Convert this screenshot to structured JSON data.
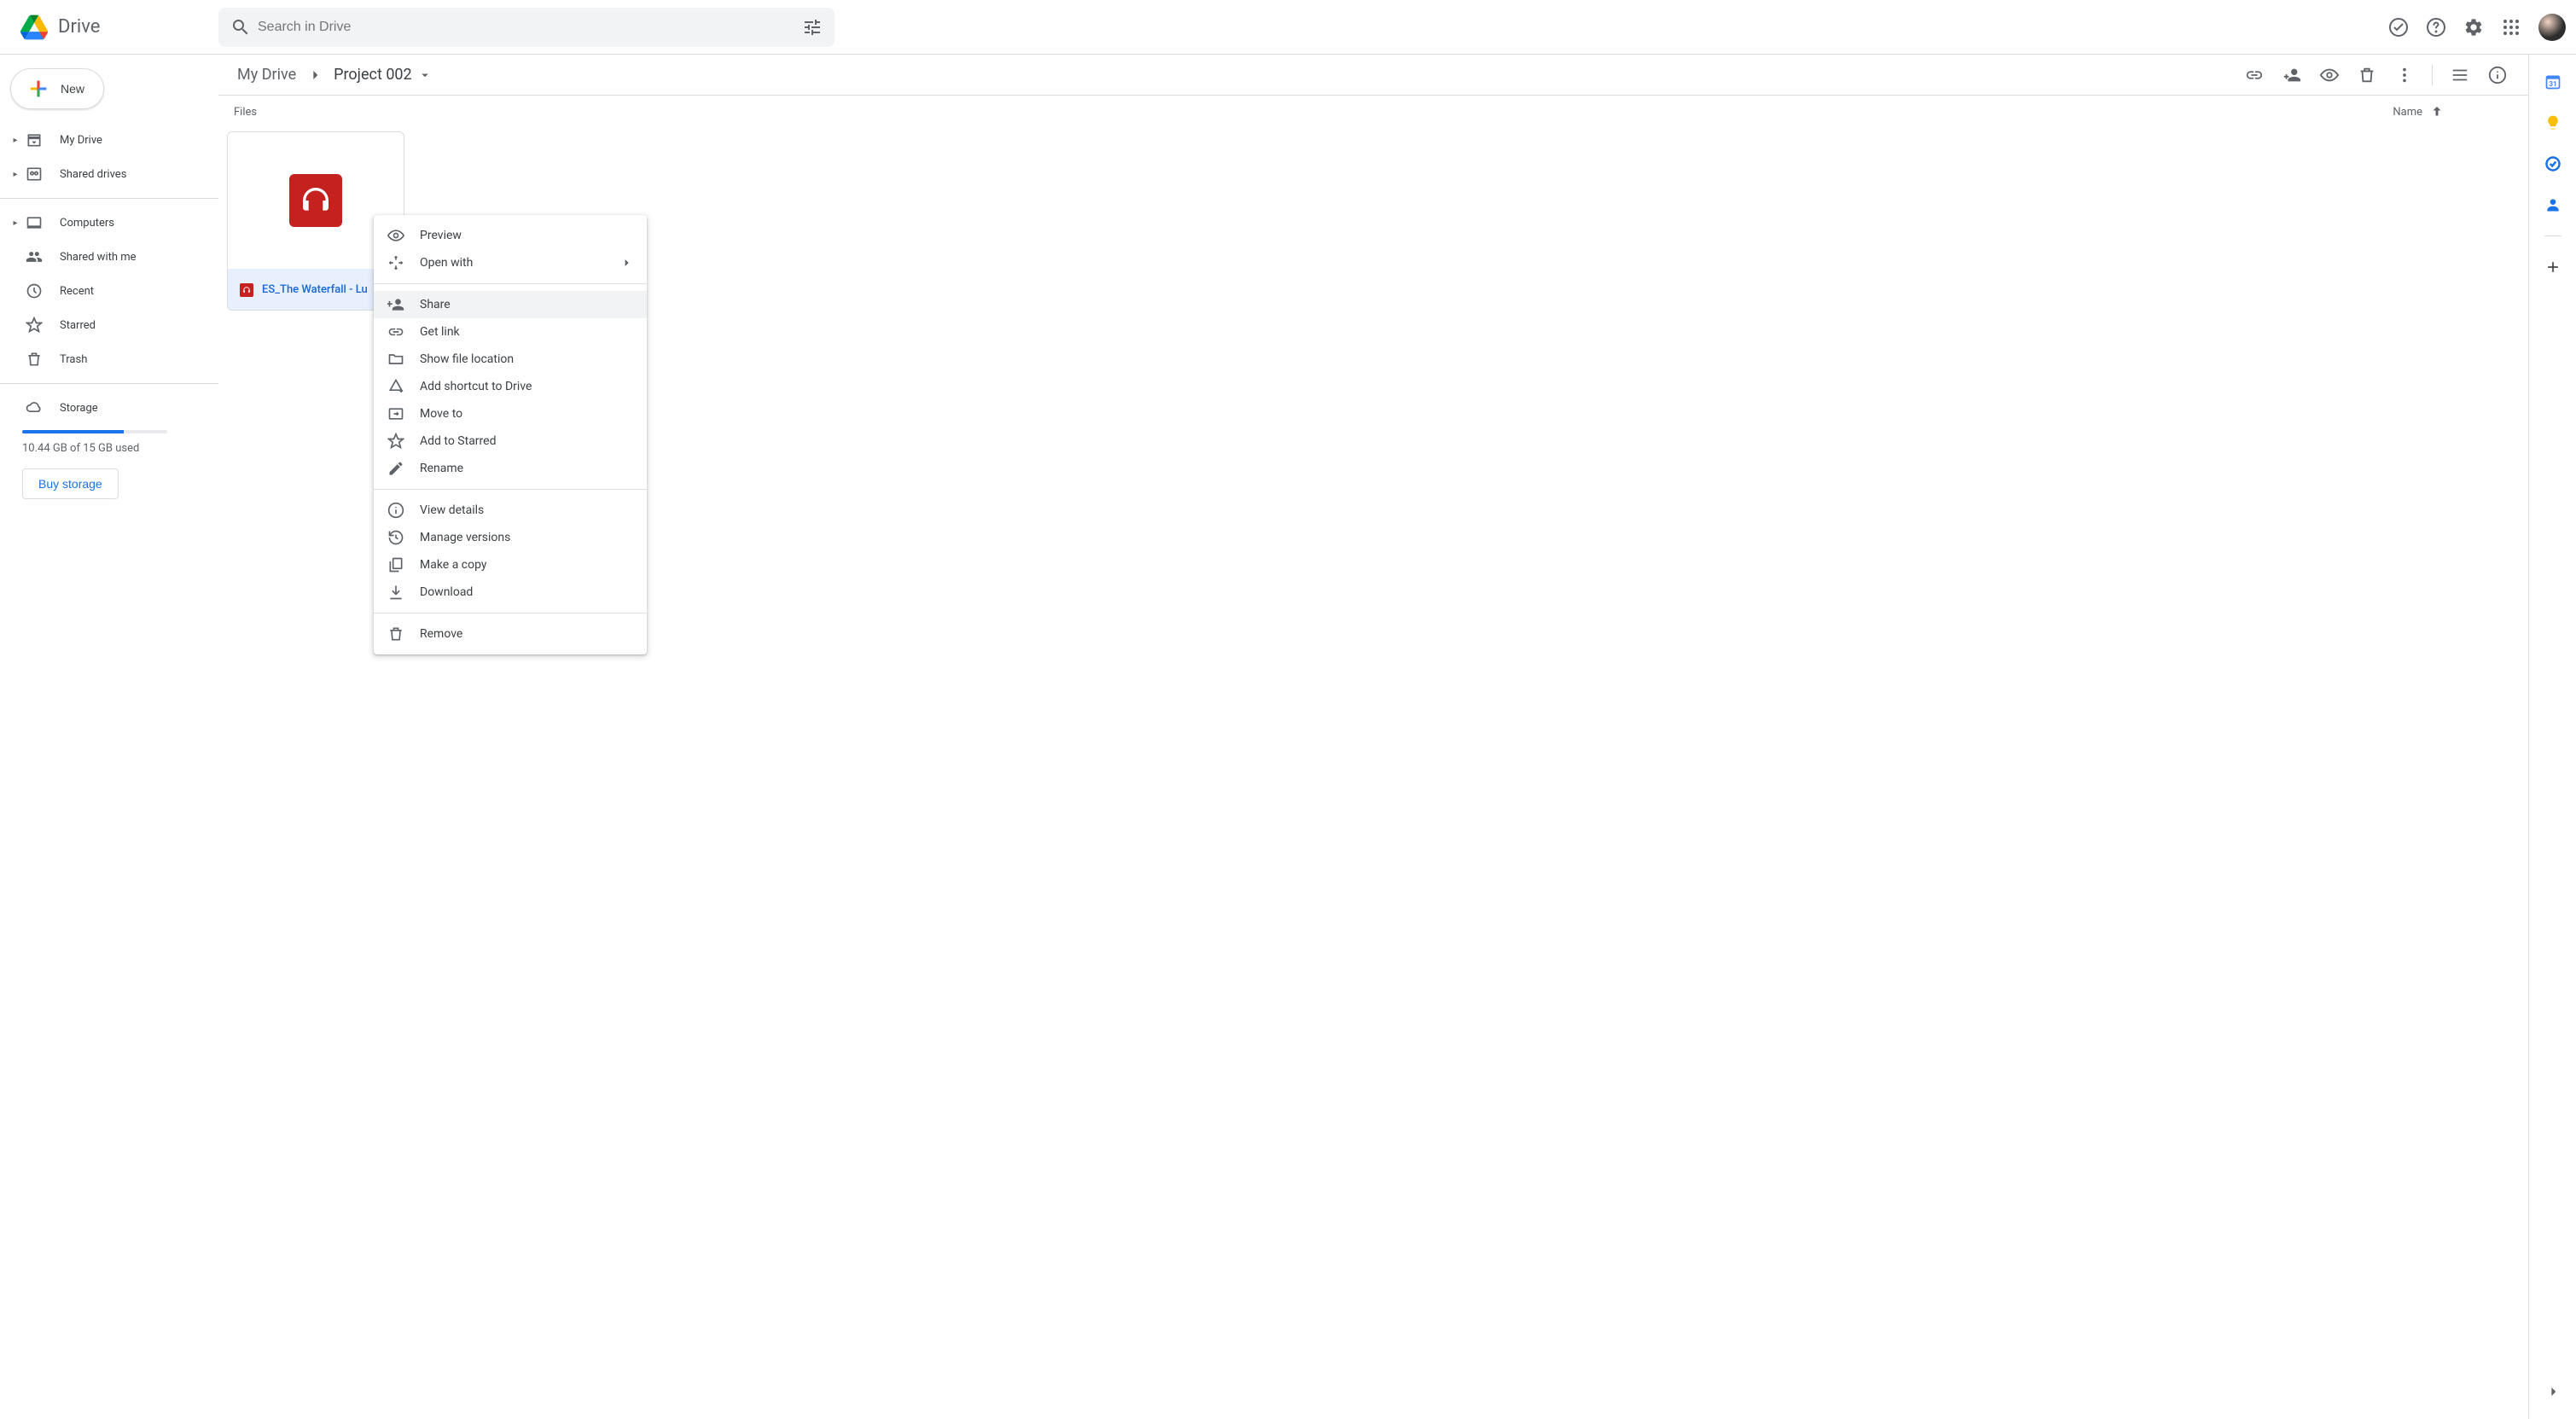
{
  "header": {
    "product_name": "Drive",
    "search_placeholder": "Search in Drive"
  },
  "new_button": "New",
  "sidebar": {
    "items": [
      {
        "label": "My Drive",
        "expandable": true
      },
      {
        "label": "Shared drives",
        "expandable": true
      },
      {
        "label": "Computers",
        "expandable": true
      },
      {
        "label": "Shared with me",
        "expandable": false
      },
      {
        "label": "Recent",
        "expandable": false
      },
      {
        "label": "Starred",
        "expandable": false
      },
      {
        "label": "Trash",
        "expandable": false
      },
      {
        "label": "Storage",
        "expandable": false
      }
    ],
    "storage_text": "10.44 GB of 15 GB used",
    "storage_percent": 70,
    "buy_label": "Buy storage"
  },
  "breadcrumb": {
    "root": "My Drive",
    "current": "Project 002"
  },
  "list_header": {
    "files_label": "Files",
    "name_label": "Name"
  },
  "files": [
    {
      "name": "ES_The Waterfall - Lu"
    }
  ],
  "context_menu": {
    "groups": [
      [
        {
          "label": "Preview",
          "icon": "eye"
        },
        {
          "label": "Open with",
          "icon": "open-with",
          "submenu": true
        }
      ],
      [
        {
          "label": "Share",
          "icon": "person-add",
          "highlight": true
        },
        {
          "label": "Get link",
          "icon": "link"
        },
        {
          "label": "Show file location",
          "icon": "folder"
        },
        {
          "label": "Add shortcut to Drive",
          "icon": "drive-shortcut"
        },
        {
          "label": "Move to",
          "icon": "move"
        },
        {
          "label": "Add to Starred",
          "icon": "star"
        },
        {
          "label": "Rename",
          "icon": "pencil"
        }
      ],
      [
        {
          "label": "View details",
          "icon": "info"
        },
        {
          "label": "Manage versions",
          "icon": "history"
        },
        {
          "label": "Make a copy",
          "icon": "copy"
        },
        {
          "label": "Download",
          "icon": "download"
        }
      ],
      [
        {
          "label": "Remove",
          "icon": "trash"
        }
      ]
    ]
  }
}
